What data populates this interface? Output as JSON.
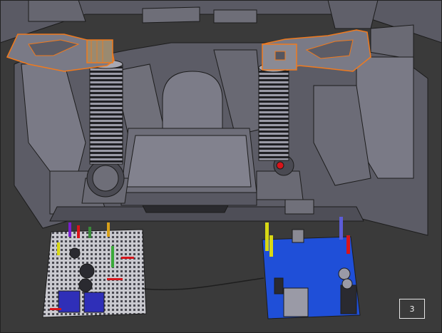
{
  "viewport": {
    "background": "#3a3a3a",
    "layer_badge": "3"
  },
  "scene": {
    "objects": [
      {
        "name": "left-robot-arm",
        "selected": true
      },
      {
        "name": "right-robot-arm",
        "selected": true
      },
      {
        "name": "left-spring-column",
        "selected": false
      },
      {
        "name": "right-spring-column",
        "selected": false
      },
      {
        "name": "central-platform",
        "selected": false
      },
      {
        "name": "breadboard",
        "selected": false
      },
      {
        "name": "arduino-board",
        "selected": false
      }
    ],
    "colors": {
      "mesh_gray": "#72727e",
      "mesh_dark": "#55555f",
      "wire": "#1e1e1e",
      "selection_orange": "#f07a1e",
      "arduino_blue": "#1f4fd8",
      "breadboard_white": "#c9c9cf",
      "led_red": "#d8141a"
    }
  }
}
